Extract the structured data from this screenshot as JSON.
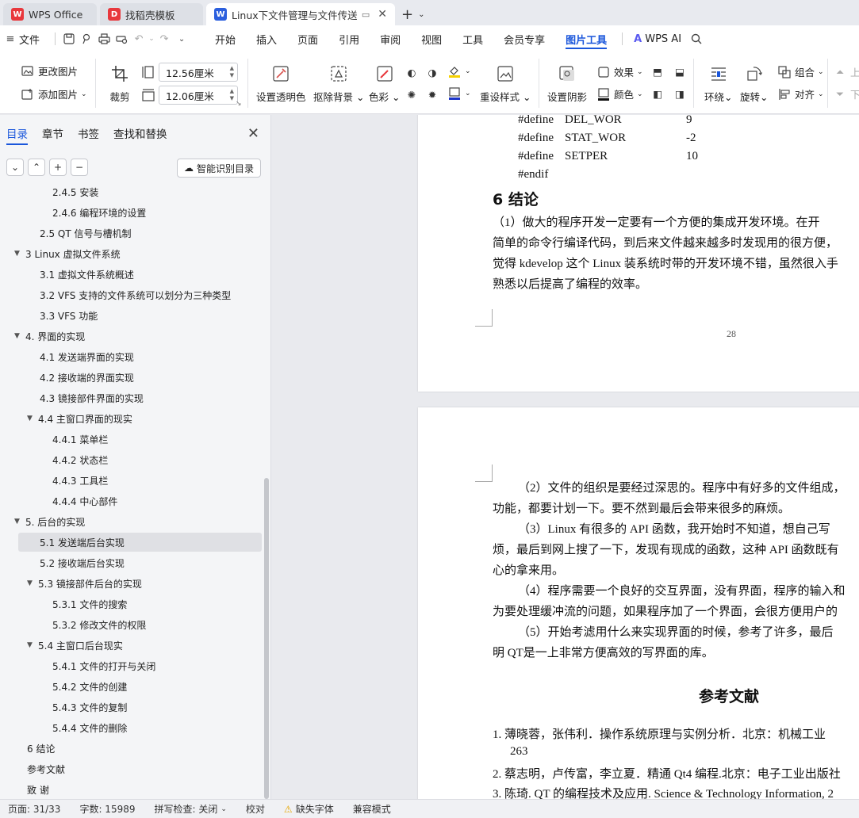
{
  "tabs": [
    {
      "label": "WPS Office",
      "logo": "W"
    },
    {
      "label": "找稻壳模板",
      "logo": "D"
    },
    {
      "label": "Linux下文件管理与文件传送的",
      "logo": "W"
    }
  ],
  "menu": {
    "file": "文件",
    "items": [
      "开始",
      "插入",
      "页面",
      "引用",
      "审阅",
      "视图",
      "工具",
      "会员专享",
      "图片工具"
    ],
    "active": "图片工具",
    "wps_ai": "WPS AI"
  },
  "ribbon": {
    "change_picture": "更改图片",
    "add_picture": "添加图片",
    "crop": "裁剪",
    "width_value": "12.56厘米",
    "height_value": "12.06厘米",
    "set_transparent": "设置透明色",
    "remove_bg": "抠除背景",
    "color": "色彩",
    "reset_style": "重设样式",
    "set_shadow": "设置阴影",
    "effect": "效果",
    "shade_color": "颜色",
    "wrap": "环绕",
    "rotate": "旋转",
    "group": "组合",
    "align": "对齐",
    "up": "上",
    "down": "下"
  },
  "left_panel": {
    "tabs": [
      "目录",
      "章节",
      "书签",
      "查找和替换"
    ],
    "active_tab": "目录",
    "smart_toc": "智能识别目录",
    "toc": [
      {
        "label": "2.4.5 安装",
        "level": 3
      },
      {
        "label": "2.4.6  编程环境的设置",
        "level": 3
      },
      {
        "label": "2.5  QT 信号与槽机制",
        "level": 2
      },
      {
        "label": "3  Linux 虚拟文件系统",
        "level": 1,
        "expanded": true
      },
      {
        "label": "3.1 虚拟文件系统概述",
        "level": 2
      },
      {
        "label": "3.2  VFS 支持的文件系统可以划分为三种类型",
        "level": 2
      },
      {
        "label": "3.3 VFS 功能",
        "level": 2
      },
      {
        "label": "4.  界面的实现",
        "level": 1,
        "expanded": true
      },
      {
        "label": "4.1 发送端界面的实现",
        "level": 2
      },
      {
        "label": "4.2 接收端的界面实现",
        "level": 2
      },
      {
        "label": "4.3 镜接部件界面的实现",
        "level": 2
      },
      {
        "label": "4.4 主窗口界面的现实",
        "level": 2,
        "expanded": true
      },
      {
        "label": "4.4.1 菜单栏",
        "level": 3
      },
      {
        "label": "4.4.2 状态栏",
        "level": 3
      },
      {
        "label": "4.4.3 工具栏",
        "level": 3
      },
      {
        "label": "4.4.4 中心部件",
        "level": 3
      },
      {
        "label": "5. 后台的实现",
        "level": 1,
        "expanded": true
      },
      {
        "label": "5.1 发送端后台实现",
        "level": 2,
        "selected": true
      },
      {
        "label": "5.2 接收端后台实现",
        "level": 2
      },
      {
        "label": "5.3 镜接部件后台的实现",
        "level": 2,
        "expanded": true
      },
      {
        "label": "5.3.1 文件的搜索",
        "level": 3
      },
      {
        "label": "5.3.2  修改文件的权限",
        "level": 3
      },
      {
        "label": "5.4 主窗口后台现实",
        "level": 2,
        "expanded": true
      },
      {
        "label": "5.4.1 文件的打开与关闭",
        "level": 3
      },
      {
        "label": "5.4.2 文件的创建",
        "level": 3
      },
      {
        "label": "5.4.3 文件的复制",
        "level": 3
      },
      {
        "label": "5.4.4 文件的删除",
        "level": 3
      },
      {
        "label": "6  结论",
        "level": 1
      },
      {
        "label": "参考文献",
        "level": 1
      },
      {
        "label": "致  谢",
        "level": 1
      }
    ]
  },
  "document": {
    "code_lines": [
      {
        "kw": "#define",
        "name": "DEL_WOR",
        "val": "9"
      },
      {
        "kw": "#define",
        "name": "STAT_WOR",
        "val": "-2"
      },
      {
        "kw": "#define",
        "name": "SETPER",
        "val": "10"
      },
      {
        "kw": "#endif",
        "name": "",
        "val": ""
      }
    ],
    "section_heading": "6  结论",
    "para1": [
      "（1）做大的程序开发一定要有一个方便的集成开发环境。在开",
      "简单的命令行编译代码，到后来文件越来越多时发现用的很方便，",
      "觉得 kdevelop 这个 Linux 装系统时带的开发环境不错，虽然很入手",
      "熟悉以后提高了编程的效率。"
    ],
    "page_number": "28",
    "para2": [
      "（2）文件的组织是要经过深思的。程序中有好多的文件组成，",
      "功能，都要计划一下。要不然到最后会带来很多的麻烦。",
      "（3）Linux 有很多的 API 函数，我开始时不知道，想自己写",
      "烦，最后到网上搜了一下，发现有现成的函数，这种 API 函数既有",
      "心的拿来用。",
      "（4）程序需要一个良好的交互界面，没有界面，程序的输入和",
      "为要处理缓冲流的问题，如果程序加了一个界面，会很方便用户的",
      "（5）开始考滤用什么来实现界面的时候，参考了许多，最后",
      "明 QT是一上非常方便高效的写界面的库。"
    ],
    "refs_heading": "参考文献",
    "refs": [
      "1.  薄晓蓉，张伟利．操作系统原理与实例分析．北京：机械工业",
      "263",
      "2.  蔡志明，卢传富，李立夏．精通 Qt4 编程.北京：电子工业出版社",
      "3.  陈琦. QT 的编程技术及应用. Science & Technology Information, 2"
    ]
  },
  "status": {
    "page": "页面: 31/33",
    "words": "字数: 15989",
    "spell": "拼写检查: 关闭",
    "proof": "校对",
    "missing_font": "缺失字体",
    "compat": "兼容模式"
  },
  "colors": {
    "accent": "#1a56db",
    "wps_red": "#e8383d",
    "doc_blue": "#2b5fde"
  }
}
